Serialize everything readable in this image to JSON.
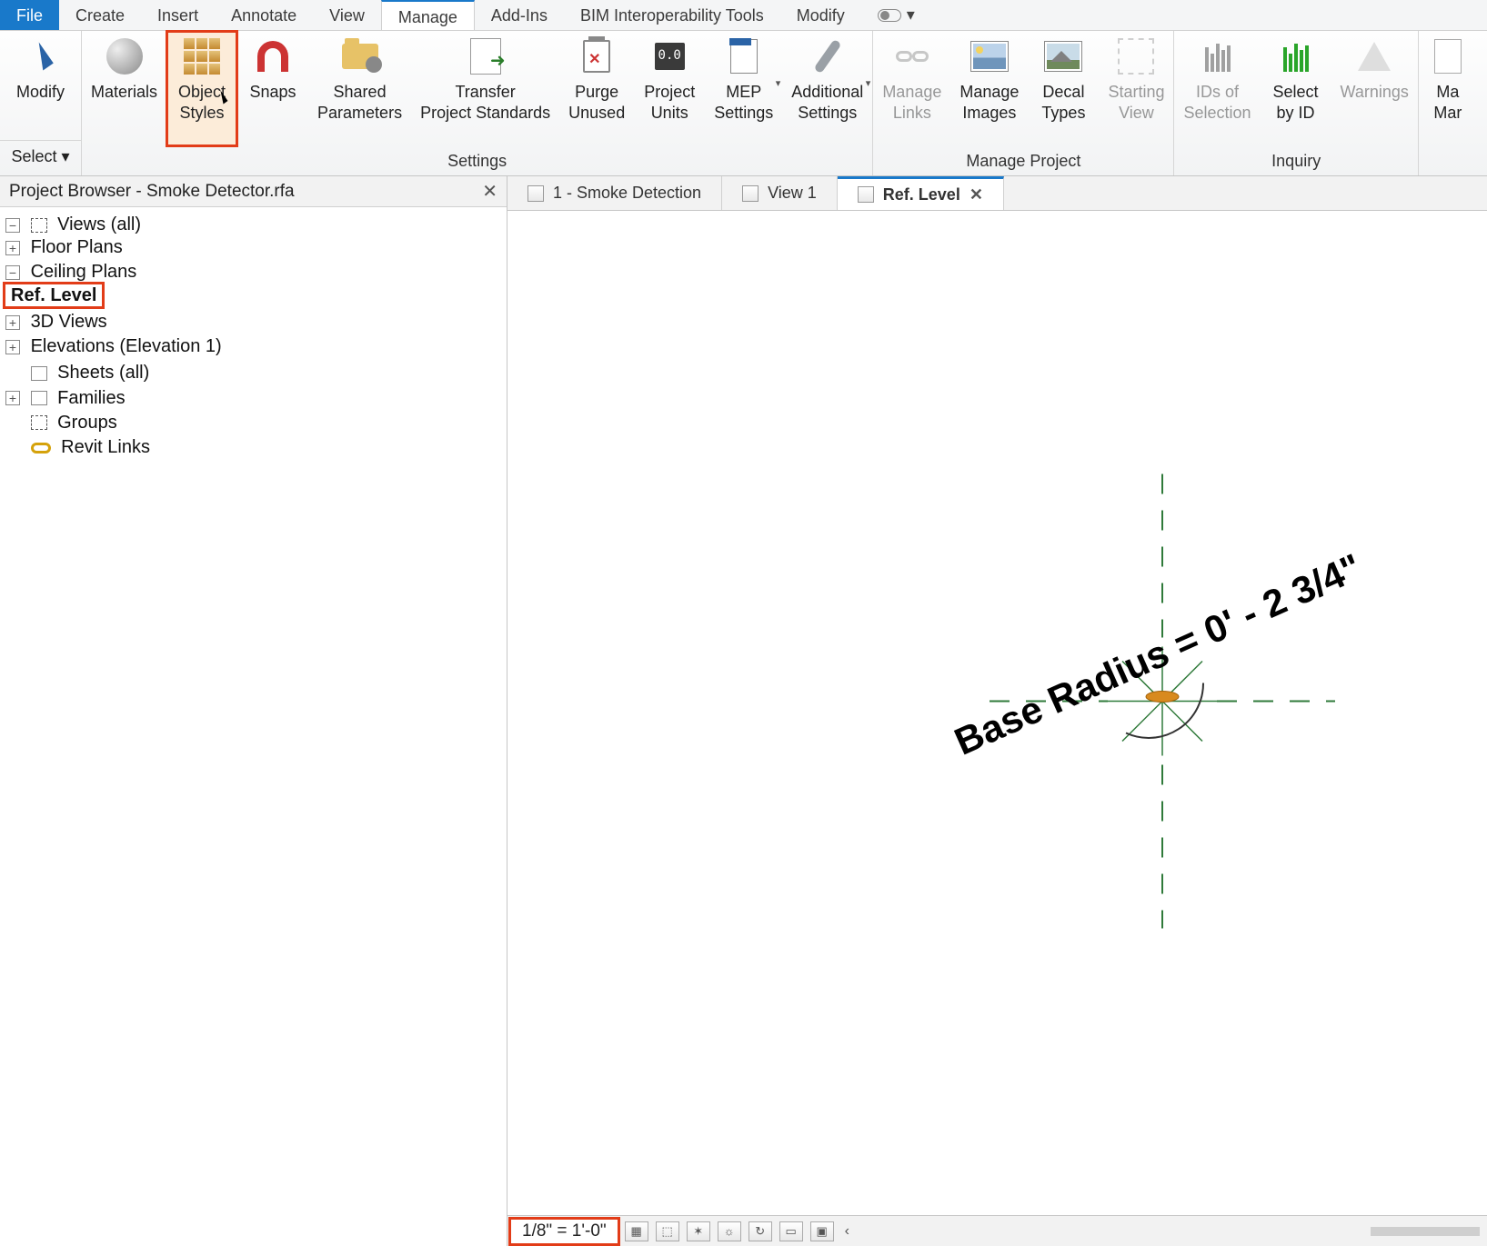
{
  "menu": {
    "file": "File",
    "tabs": [
      "Create",
      "Insert",
      "Annotate",
      "View",
      "Manage",
      "Add-Ins",
      "BIM Interoperability Tools",
      "Modify"
    ],
    "active": "Manage"
  },
  "ribbon": {
    "select": {
      "modify": "Modify",
      "select": "Select"
    },
    "settings_panel": "Settings",
    "manage_project_panel": "Manage Project",
    "inquiry_panel": "Inquiry",
    "buttons": {
      "materials": "Materials",
      "object_styles": "Object\nStyles",
      "snaps": "Snaps",
      "shared_parameters": "Shared\nParameters",
      "transfer_project_standards": "Transfer\nProject Standards",
      "purge_unused": "Purge\nUnused",
      "project_units": "Project\nUnits",
      "mep_settings": "MEP\nSettings",
      "additional_settings": "Additional\nSettings",
      "manage_links": "Manage\nLinks",
      "manage_images": "Manage\nImages",
      "decal_types": "Decal\nTypes",
      "starting_view": "Starting\nView",
      "ids_of_selection": "IDs of\nSelection",
      "select_by_id": "Select\nby ID",
      "warnings": "Warnings",
      "ma": "Ma\nMar"
    }
  },
  "project_browser": {
    "title": "Project Browser - Smoke Detector.rfa",
    "views_all": "Views (all)",
    "floor_plans": "Floor Plans",
    "ceiling_plans": "Ceiling Plans",
    "ref_level": "Ref. Level",
    "three_d_views": "3D Views",
    "elevations": "Elevations (Elevation 1)",
    "sheets_all": "Sheets (all)",
    "families": "Families",
    "groups": "Groups",
    "revit_links": "Revit Links"
  },
  "doc_tabs": {
    "t1": "1 - Smoke Detection",
    "t2": "View 1",
    "t3": "Ref. Level"
  },
  "canvas": {
    "dimension_label": "Base Radius = 0' - 2 3/4\""
  },
  "viewbar": {
    "scale": "1/8\" = 1'-0\""
  }
}
